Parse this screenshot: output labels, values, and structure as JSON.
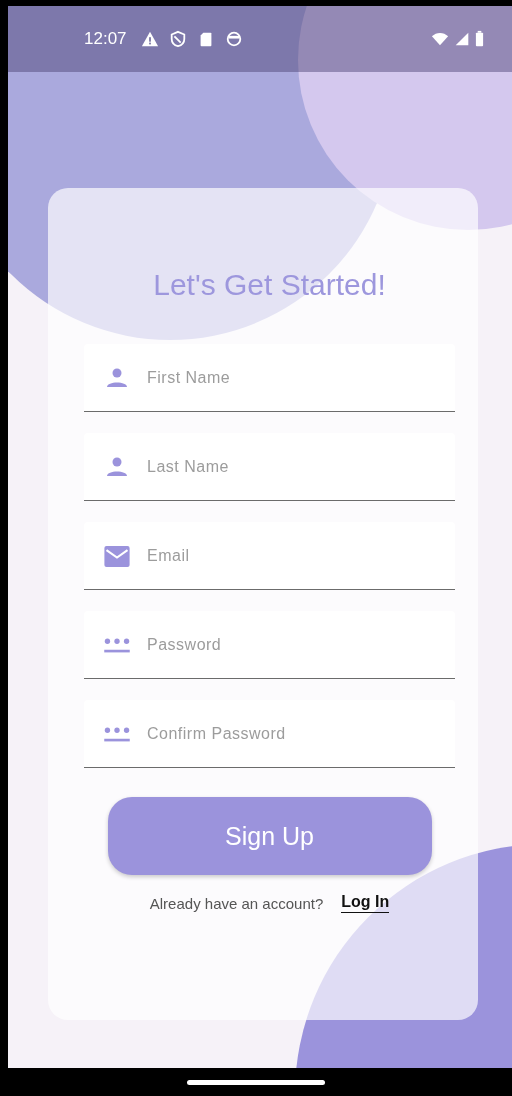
{
  "status_bar": {
    "time": "12:07"
  },
  "title": "Let's Get Started!",
  "fields": [
    {
      "kind": "person",
      "placeholder": "First Name"
    },
    {
      "kind": "person",
      "placeholder": "Last Name"
    },
    {
      "kind": "email",
      "placeholder": "Email"
    },
    {
      "kind": "password",
      "placeholder": "Password"
    },
    {
      "kind": "password",
      "placeholder": "Confirm Password"
    }
  ],
  "primary_button": "Sign Up",
  "login_prompt": {
    "text": "Already have an account?",
    "link": "Log In"
  }
}
